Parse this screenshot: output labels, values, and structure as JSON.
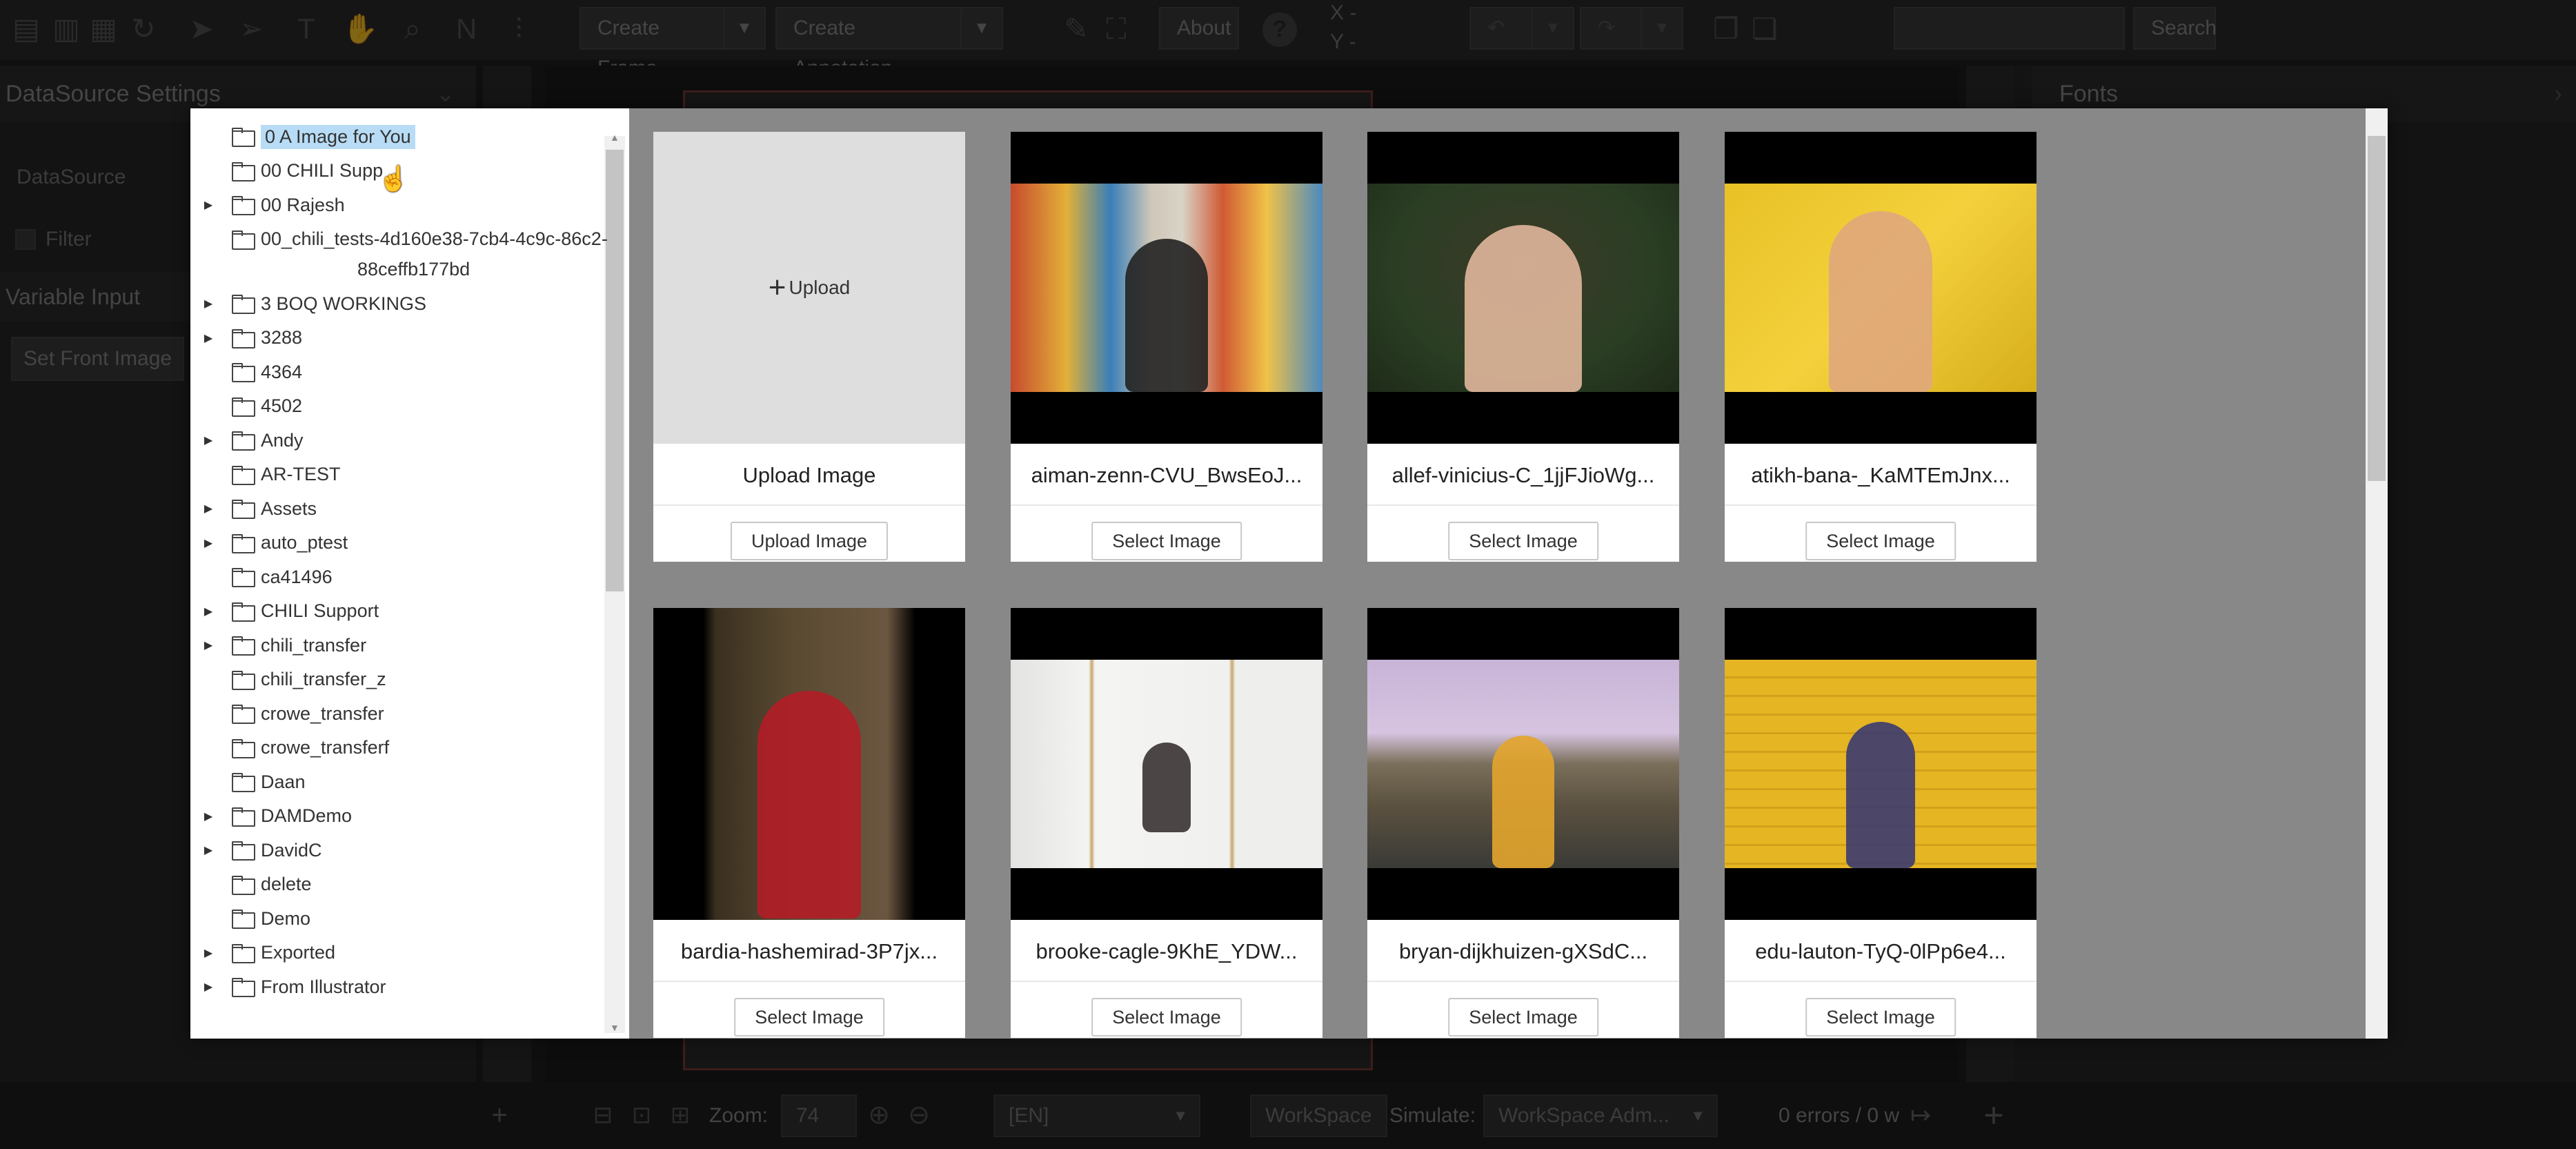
{
  "toolbar": {
    "create_frame": "Create Frame",
    "create_annotation": "Create Annotation",
    "about": "About",
    "help": "?",
    "coord_x": "X -",
    "coord_y": "Y -",
    "search": "Search"
  },
  "left_panel": {
    "title": "DataSource Settings",
    "datasource": "DataSource",
    "filter": "Filter",
    "variable_input": "Variable Input",
    "set_front_image": "Set Front Image"
  },
  "right_panel": {
    "title": "Fonts"
  },
  "bottom_bar": {
    "zoom_label": "Zoom:",
    "zoom_value": "74",
    "language": "[EN]",
    "workspace": "WorkSpace",
    "simulate_label": "Simulate:",
    "simulate_value": "WorkSpace Adm...",
    "status": "0 errors / 0 w"
  },
  "tree": {
    "items": [
      {
        "label": "0 A Image for You",
        "expandable": false,
        "selected": true
      },
      {
        "label": "00 CHILI Supp",
        "expandable": false
      },
      {
        "label": "00 Rajesh",
        "expandable": true
      },
      {
        "label": "00_chili_tests-4d160e38-7cb4-4c9c-86c2-",
        "label2": "88ceffb177bd",
        "expandable": false
      },
      {
        "label": "3 BOQ WORKINGS",
        "expandable": true
      },
      {
        "label": "3288",
        "expandable": true
      },
      {
        "label": "4364",
        "expandable": false
      },
      {
        "label": "4502",
        "expandable": false
      },
      {
        "label": "Andy",
        "expandable": true
      },
      {
        "label": "AR-TEST",
        "expandable": false
      },
      {
        "label": "Assets",
        "expandable": true
      },
      {
        "label": "auto_ptest",
        "expandable": true
      },
      {
        "label": "ca41496",
        "expandable": false
      },
      {
        "label": "CHILI Support",
        "expandable": true
      },
      {
        "label": "chili_transfer",
        "expandable": true
      },
      {
        "label": "chili_transfer_z",
        "expandable": false
      },
      {
        "label": "crowe_transfer",
        "expandable": false
      },
      {
        "label": "crowe_transferf",
        "expandable": false
      },
      {
        "label": "Daan",
        "expandable": false
      },
      {
        "label": "DAMDemo",
        "expandable": true
      },
      {
        "label": "DavidC",
        "expandable": true
      },
      {
        "label": "delete",
        "expandable": false
      },
      {
        "label": "Demo",
        "expandable": false
      },
      {
        "label": "Exported",
        "expandable": true
      },
      {
        "label": "From Illustrator",
        "expandable": true
      }
    ]
  },
  "cards": [
    {
      "title": "Upload Image",
      "button": "Upload Image",
      "upload": true,
      "upload_label": "Upload"
    },
    {
      "title": "aiman-zenn-CVU_BwsEoJ...",
      "button": "Select Image"
    },
    {
      "title": "allef-vinicius-C_1jjFJioWg...",
      "button": "Select Image"
    },
    {
      "title": "atikh-bana-_KaMTEmJnx...",
      "button": "Select Image"
    },
    {
      "title": "bardia-hashemirad-3P7jx...",
      "button": "Select Image"
    },
    {
      "title": "brooke-cagle-9KhE_YDW...",
      "button": "Select Image"
    },
    {
      "title": "bryan-dijkhuizen-gXSdC...",
      "button": "Select Image"
    },
    {
      "title": "edu-lauton-TyQ-0lPp6e4...",
      "button": "Select Image"
    }
  ]
}
